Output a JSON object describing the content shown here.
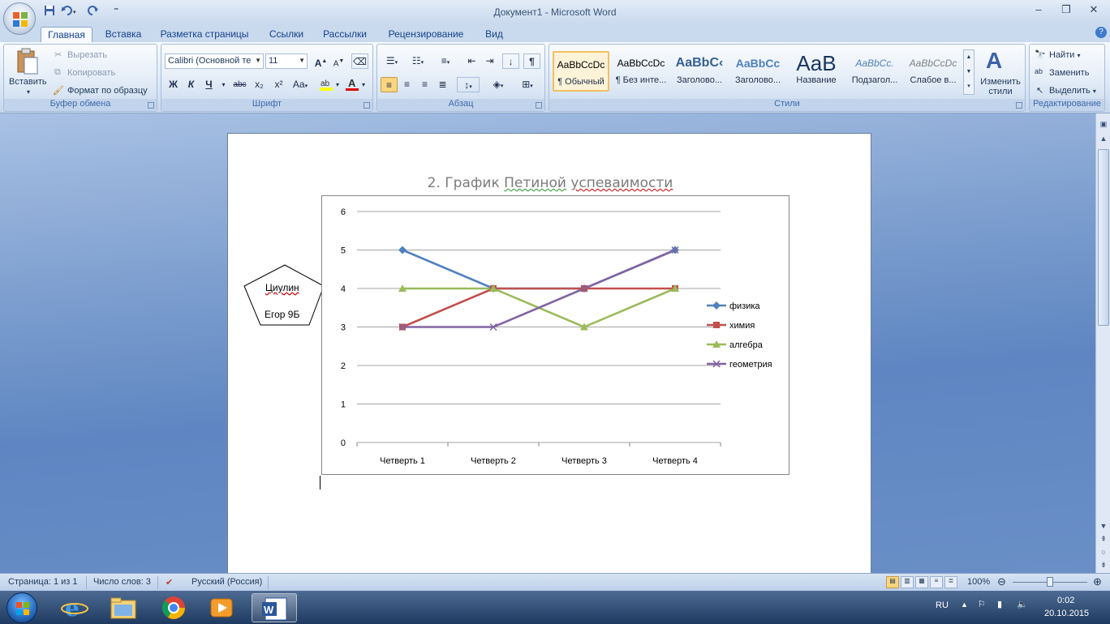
{
  "window": {
    "title": "Документ1 - Microsoft Word",
    "controls": {
      "minimize": "–",
      "restore": "❐",
      "close": "✕"
    }
  },
  "qat": {
    "more": "⁼"
  },
  "tabs": [
    {
      "label": "Главная",
      "active": true
    },
    {
      "label": "Вставка"
    },
    {
      "label": "Разметка страницы"
    },
    {
      "label": "Ссылки"
    },
    {
      "label": "Рассылки"
    },
    {
      "label": "Рецензирование"
    },
    {
      "label": "Вид"
    }
  ],
  "help": "?",
  "ribbon": {
    "clipboard": {
      "label": "Буфер обмена",
      "paste": "Вставить",
      "cut": "Вырезать",
      "copy": "Копировать",
      "format_painter": "Формат по образцу"
    },
    "font": {
      "label": "Шрифт",
      "font_name": "Calibri (Основной те",
      "font_size": "11",
      "bold": "Ж",
      "italic": "К",
      "underline": "Ч",
      "strike": "abc",
      "sub": "x₂",
      "sup": "x²",
      "case": "Aa",
      "grow": "A",
      "shrink": "A"
    },
    "paragraph": {
      "label": "Абзац"
    },
    "styles": {
      "label": "Стили",
      "change": "Изменить стили",
      "items": [
        {
          "sample": "AaBbCcDc",
          "name": "¶ Обычный",
          "selected": true
        },
        {
          "sample": "AaBbCcDc",
          "name": "¶ Без инте..."
        },
        {
          "sample": "AaBbC‹",
          "name": "Заголово..."
        },
        {
          "sample": "AaBbCc",
          "name": "Заголово..."
        },
        {
          "sample": "AaB",
          "name": "Название"
        },
        {
          "sample": "AaBbCc.",
          "name": "Подзагол..."
        },
        {
          "sample": "AaBbCcDc",
          "name": "Слабое в..."
        }
      ]
    },
    "editing": {
      "label": "Редактирование",
      "find": "Найти",
      "replace": "Заменить",
      "select": "Выделить"
    }
  },
  "document": {
    "pentagon_line1": "Циулин",
    "pentagon_line2": "Егор 9Б",
    "title_prefix": "2. График ",
    "title_word1": "Петиной",
    "title_word2": "успеваимости"
  },
  "chart_data": {
    "type": "line",
    "title": "2. График Петиной успеваимости",
    "categories": [
      "Четверть 1",
      "Четверть 2",
      "Четверть 3",
      "Четверть 4"
    ],
    "series": [
      {
        "name": "физика",
        "values": [
          5,
          4,
          4,
          5
        ],
        "color": "#4f81bd",
        "marker": "diamond"
      },
      {
        "name": "химия",
        "values": [
          3,
          4,
          4,
          4
        ],
        "color": "#c0504d",
        "marker": "square"
      },
      {
        "name": "алгебра",
        "values": [
          4,
          4,
          3,
          4
        ],
        "color": "#9bbb59",
        "marker": "triangle"
      },
      {
        "name": "геометрия",
        "values": [
          3,
          3,
          4,
          5
        ],
        "color": "#8064a2",
        "marker": "x"
      }
    ],
    "ylim": [
      0,
      6
    ],
    "yticks": [
      0,
      1,
      2,
      3,
      4,
      5,
      6
    ],
    "grid": true,
    "legend": "right"
  },
  "status": {
    "page": "Страница: 1 из 1",
    "words": "Число слов: 3",
    "language": "Русский (Россия)",
    "zoom": "100%"
  },
  "taskbar": {
    "lang": "RU",
    "time": "0:02",
    "date": "20.10.2015"
  }
}
